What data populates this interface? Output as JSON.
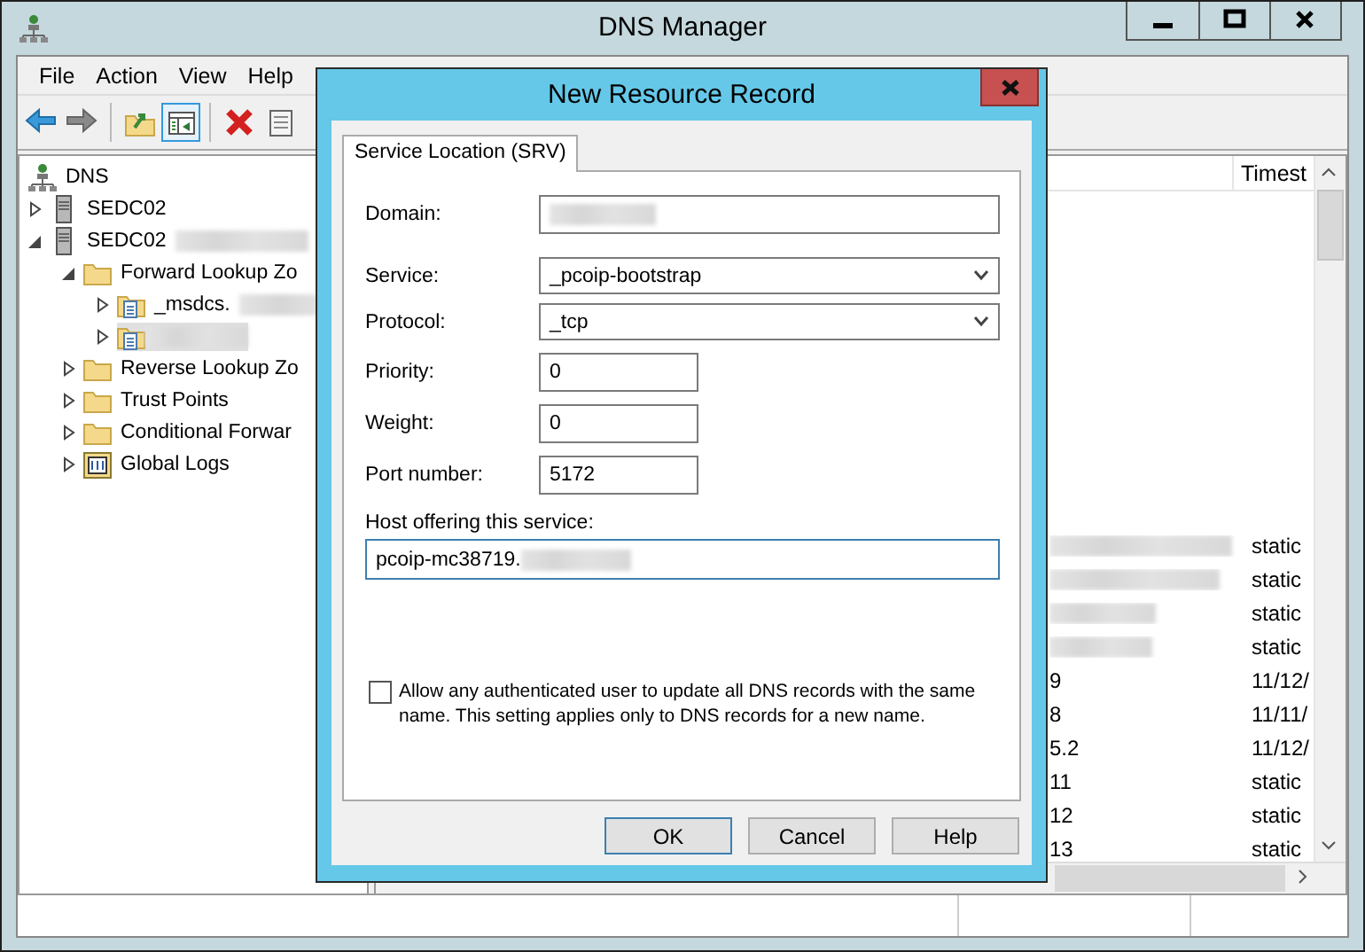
{
  "window": {
    "title": "DNS Manager"
  },
  "menu": [
    "File",
    "Action",
    "View",
    "Help"
  ],
  "toolbar": [
    {
      "kind": "back",
      "selected": false
    },
    {
      "kind": "forward",
      "selected": false
    },
    {
      "kind": "up",
      "selected": false
    },
    {
      "kind": "tree",
      "selected": true
    },
    {
      "kind": "delete",
      "selected": false
    },
    {
      "kind": "properties",
      "selected": false
    }
  ],
  "tree": [
    {
      "label": "DNS",
      "kind": "dns",
      "selected": false,
      "children": [
        {
          "label": "SEDC02",
          "kind": "server",
          "expanded": false,
          "selected": false
        },
        {
          "label": "SEDC02",
          "redacted": true,
          "kind": "server",
          "expanded": true,
          "selected": false,
          "children": [
            {
              "label": "Forward Lookup Zo",
              "kind": "folder",
              "expanded": true,
              "selected": false,
              "children": [
                {
                  "label": "_msdcs.",
                  "redacted": true,
                  "kind": "zone",
                  "expanded": false,
                  "selected": false
                },
                {
                  "redacted": true,
                  "kind": "zone",
                  "expanded": false,
                  "selected": true
                }
              ]
            },
            {
              "label": "Reverse Lookup Zo",
              "kind": "folder",
              "expanded": false,
              "selected": false
            },
            {
              "label": "Trust Points",
              "kind": "folder",
              "expanded": false,
              "selected": false
            },
            {
              "label": "Conditional Forwar",
              "kind": "folder",
              "expanded": false,
              "selected": false
            },
            {
              "label": "Global Logs",
              "kind": "log",
              "expanded": false,
              "selected": false
            }
          ]
        }
      ]
    }
  ],
  "list": {
    "timestamp_header": "Timest",
    "rows": [
      {
        "redacted": true,
        "timestamp": "static"
      },
      {
        "redacted": true,
        "timestamp": "static"
      },
      {
        "redacted": true,
        "timestamp": "static"
      },
      {
        "redacted": true,
        "timestamp": "static"
      },
      {
        "column_1": "9",
        "timestamp": "11/12/"
      },
      {
        "column_1": "8",
        "timestamp": "11/11/"
      },
      {
        "column_1": "5.2",
        "timestamp": "11/12/"
      },
      {
        "column_1": "11",
        "timestamp": "static"
      },
      {
        "column_1": "12",
        "timestamp": "static"
      },
      {
        "column_1": "13",
        "timestamp": "static"
      }
    ]
  },
  "dialog": {
    "title": "New Resource Record",
    "tabs": [
      {
        "label": "Service Location (SRV)",
        "selected": true
      }
    ],
    "fields": [
      {
        "kind": "text",
        "label": "Domain:",
        "redacted": true
      },
      {
        "kind": "select",
        "label": "Service:",
        "value": "_pcoip-bootstrap"
      },
      {
        "kind": "select",
        "label": "Protocol:",
        "value": "_tcp"
      },
      {
        "kind": "number",
        "label": "Priority:",
        "value": "0"
      },
      {
        "kind": "number",
        "label": "Weight:",
        "value": "0"
      },
      {
        "kind": "number",
        "label": "Port number:",
        "value": "5172"
      },
      {
        "kind": "wide",
        "label": "Host offering this service:",
        "value": "pcoip-mc38719.",
        "redacted": true,
        "focused": true
      }
    ],
    "checkbox": {
      "label": "Allow any authenticated user to update all DNS records with the same name. This setting applies only to DNS records for a new name.",
      "checked": false
    },
    "buttons": [
      {
        "label": "OK",
        "default": true
      },
      {
        "label": "Cancel",
        "default": false
      },
      {
        "label": "Help",
        "default": false
      }
    ]
  }
}
